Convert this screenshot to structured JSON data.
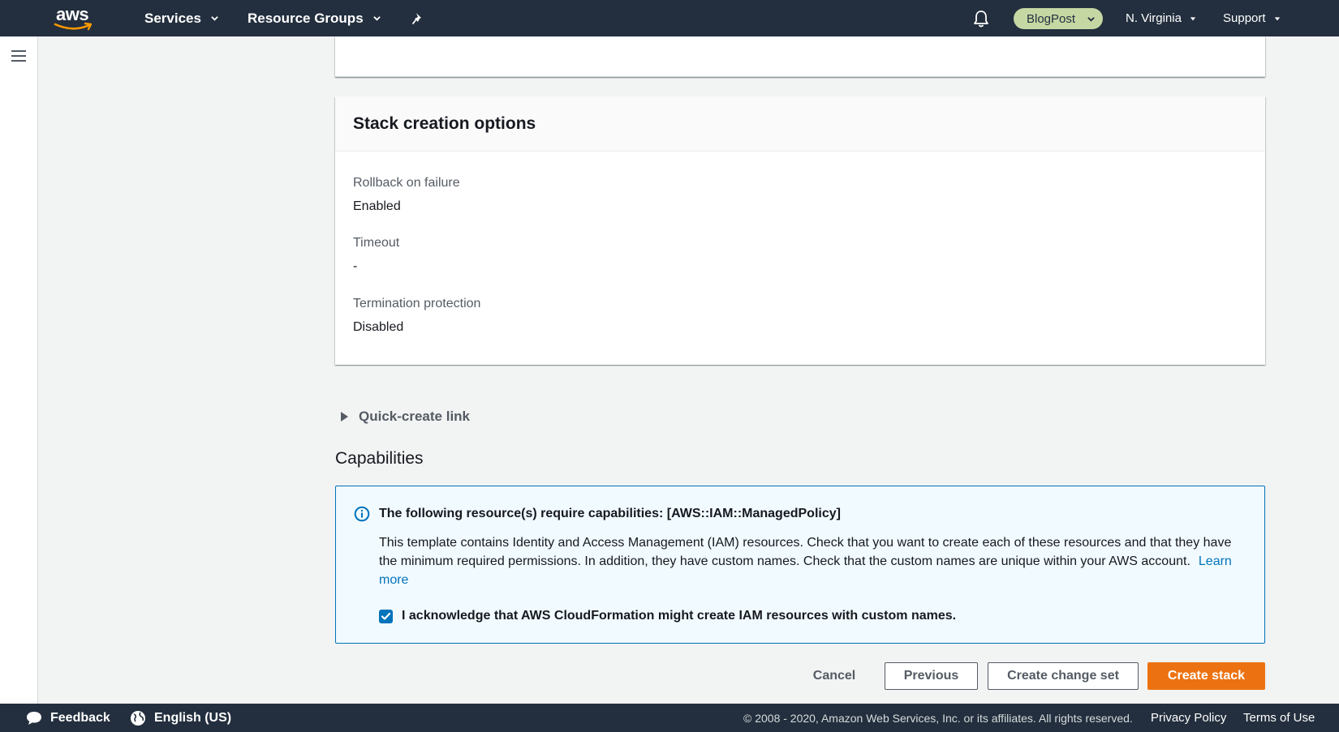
{
  "nav": {
    "logo_text": "aws",
    "services": "Services",
    "resource_groups": "Resource Groups",
    "account": "BlogPost",
    "region": "N. Virginia",
    "support": "Support"
  },
  "stack_options": {
    "title": "Stack creation options",
    "rollback_label": "Rollback on failure",
    "rollback_value": "Enabled",
    "timeout_label": "Timeout",
    "timeout_value": "-",
    "termination_label": "Termination protection",
    "termination_value": "Disabled"
  },
  "quick_create": "Quick-create link",
  "capabilities": {
    "title": "Capabilities",
    "alert_heading": "The following resource(s) require capabilities: [AWS::IAM::ManagedPolicy]",
    "alert_body": "This template contains Identity and Access Management (IAM) resources. Check that you want to create each of these resources and that they have the minimum required permissions. In addition, they have custom names. Check that the custom names are unique within your AWS account.",
    "learn_more": "Learn more",
    "ack_label": "I acknowledge that AWS CloudFormation might create IAM resources with custom names.",
    "ack_checked": true
  },
  "actions": {
    "cancel": "Cancel",
    "previous": "Previous",
    "create_change_set": "Create change set",
    "create_stack": "Create stack"
  },
  "footer": {
    "feedback": "Feedback",
    "language": "English (US)",
    "copyright": "© 2008 - 2020, Amazon Web Services, Inc. or its affiliates. All rights reserved.",
    "privacy": "Privacy Policy",
    "terms": "Terms of Use"
  },
  "colors": {
    "nav_bg": "#232f3e",
    "primary": "#ec7211",
    "link": "#0073bb",
    "account_pill": "#c5d8a4"
  }
}
